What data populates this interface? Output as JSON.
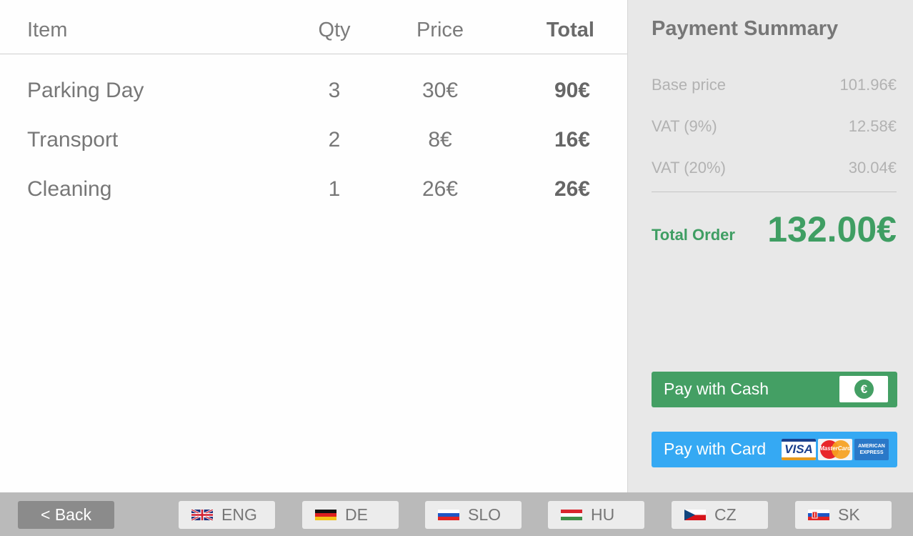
{
  "order": {
    "headers": {
      "item": "Item",
      "qty": "Qty",
      "price": "Price",
      "total": "Total"
    },
    "rows": [
      {
        "item": "Parking Day",
        "qty": "3",
        "price": "30€",
        "total": "90€"
      },
      {
        "item": "Transport",
        "qty": "2",
        "price": "8€",
        "total": "16€"
      },
      {
        "item": "Cleaning",
        "qty": "1",
        "price": "26€",
        "total": "26€"
      }
    ]
  },
  "summary": {
    "title": "Payment Summary",
    "lines": [
      {
        "label": "Base price",
        "value": "101.96€"
      },
      {
        "label": "VAT (9%)",
        "value": "12.58€"
      },
      {
        "label": "VAT (20%)",
        "value": "30.04€"
      }
    ],
    "total_label": "Total Order",
    "total_value": "132.00€",
    "pay_cash_label": "Pay with Cash",
    "pay_card_label": "Pay with Card",
    "cash_icon": "€",
    "card_logos": {
      "visa": "VISA",
      "mastercard": "MasterCard",
      "amex_line1": "AMERICAN",
      "amex_line2": "EXPRESS"
    }
  },
  "bottom_bar": {
    "back_label": "< Back",
    "languages": [
      {
        "code": "ENG",
        "flag": "uk-flag-icon"
      },
      {
        "code": "DE",
        "flag": "germany-flag-icon"
      },
      {
        "code": "SLO",
        "flag": "slovenia-flag-icon"
      },
      {
        "code": "HU",
        "flag": "hungary-flag-icon"
      },
      {
        "code": "CZ",
        "flag": "czech-flag-icon"
      },
      {
        "code": "SK",
        "flag": "slovakia-flag-icon"
      }
    ]
  },
  "colors": {
    "accent_green": "#449f64",
    "total_green": "#3f9e63",
    "card_blue": "#35a9f3",
    "panel_bg": "#e8e8e8",
    "bottom_bar_bg": "#bababa"
  }
}
